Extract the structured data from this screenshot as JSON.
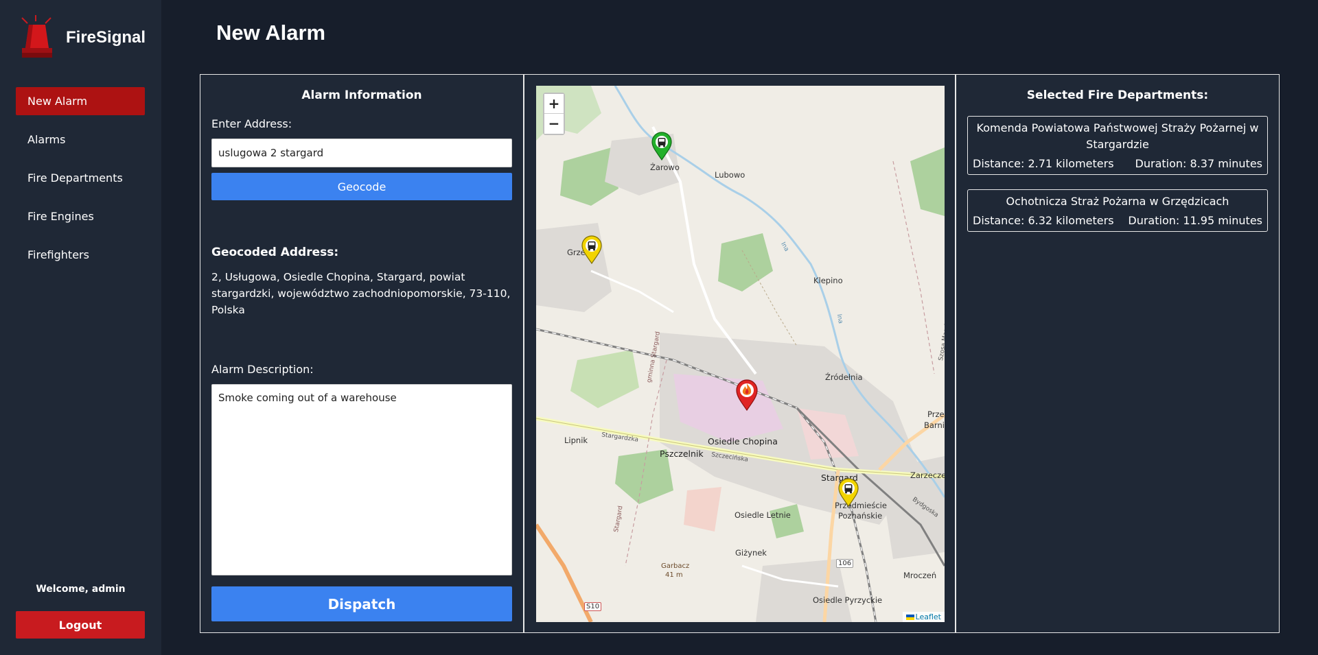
{
  "brand": {
    "name": "FireSignal"
  },
  "nav": [
    {
      "label": "New Alarm",
      "active": true
    },
    {
      "label": "Alarms"
    },
    {
      "label": "Fire Departments"
    },
    {
      "label": "Fire Engines"
    },
    {
      "label": "Firefighters"
    }
  ],
  "user": {
    "welcome": "Welcome, admin",
    "logout_label": "Logout"
  },
  "page": {
    "title": "New Alarm"
  },
  "alarm_info": {
    "title": "Alarm Information",
    "address_label": "Enter Address:",
    "address_value": "uslugowa 2 stargard",
    "geocode_label": "Geocode",
    "geocoded_heading": "Geocoded Address:",
    "geocoded_address": "2, Usługowa, Osiedle Chopina, Stargard, powiat stargardzki, województwo zachodniopomorskie, 73-110, Polska",
    "description_label": "Alarm Description:",
    "description_value": "Smoke coming out of a warehouse",
    "dispatch_label": "Dispatch"
  },
  "map": {
    "zoom_in": "+",
    "zoom_out": "−",
    "attribution": "Leaflet",
    "labels": {
      "zarowo": "Żarowo",
      "lubowo": "Lubowo",
      "klepino": "Klepino",
      "grze": "Grze",
      "zrodelnia": "Źródełnia",
      "przedm1": "Przedmieś",
      "przedm2": "Barnimows",
      "lipnik": "Lipnik",
      "osiedle_chopina": "Osiedle Chopina",
      "pszczelnik": "Pszczelnik",
      "stargard": "Stargard",
      "zarzecze": "Zarzecze",
      "przedm_pozn1": "Przedmieście",
      "przedm_pozn2": "Poznańskie",
      "osiedle_letnie": "Osiedle Letnie",
      "gizynek": "Giżynek",
      "garbacz": "Garbacz",
      "garbacz_h": "41 m",
      "mroczen": "Mroczeń",
      "osiedle_pyrzyckie": "Osiedle Pyrzyckie",
      "road_s10": "S10",
      "road_106": "106",
      "road_stargardzka": "Stargardzka",
      "road_szczecinska": "Szczecińska",
      "road_gminna": "gminna Stargard",
      "road_stargard": "Stargard",
      "road_ina1": "Ina",
      "road_ina2": "Ina",
      "road_bydgoska": "Bydgoska",
      "road_masztowa": "Szosa Maszkowska"
    }
  },
  "departments": {
    "title": "Selected Fire Departments:",
    "items": [
      {
        "name": "Komenda Powiatowa Państwowej Straży Pożarnej w Stargardzie",
        "distance": "Distance: 2.71 kilometers",
        "duration": "Duration: 8.37 minutes"
      },
      {
        "name": "Ochotnicza Straż Pożarna w Grzędzicach",
        "distance": "Distance: 6.32 kilometers",
        "duration": "Duration: 11.95 minutes"
      }
    ]
  },
  "colors": {
    "accent": "#3b82f0",
    "active_nav": "#ad1212",
    "logout": "#c81b1f",
    "marker_fire": "#e02424",
    "marker_station": "#f2d400",
    "marker_start": "#23b02b"
  }
}
